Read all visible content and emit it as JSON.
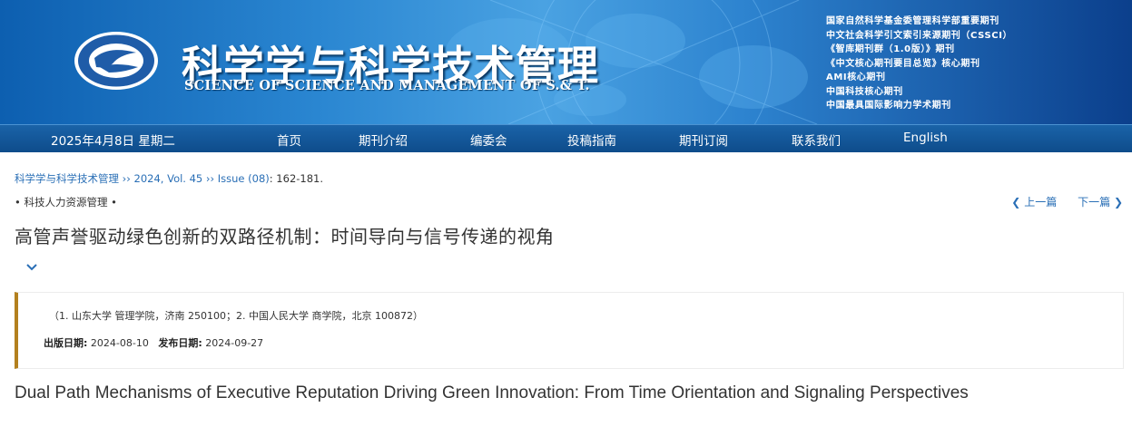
{
  "banner": {
    "journal_title_cn": "科学学与科学技术管理",
    "journal_title_en": "SCIENCE OF SCIENCE AND MANAGEMENT OF S.& T.",
    "indexing": [
      "国家自然科学基金委管理科学部重要期刊",
      "中文社会科学引文索引来源期刊（CSSCI）",
      "《智库期刊群（1.0版）》期刊",
      "《中文核心期刊要目总览》核心期刊",
      "AMI核心期刊",
      "中国科技核心期刊",
      "中国最具国际影响力学术期刊"
    ]
  },
  "nav": {
    "date": "2025年4月8日 星期二",
    "items": [
      "首页",
      "期刊介绍",
      "编委会",
      "投稿指南",
      "期刊订阅",
      "联系我们",
      "English"
    ]
  },
  "breadcrumb": {
    "journal": "科学学与科学技术管理",
    "sep": "››",
    "year_vol": "2024, Vol. 45",
    "issue": "Issue (08)",
    "pages": ": 162-181."
  },
  "article": {
    "column": "• 科技人力资源管理 •",
    "prev_label": "上一篇",
    "next_label": "下一篇",
    "title_cn": "高管声誉驱动绿色创新的双路径机制：时间导向与信号传递的视角",
    "affiliations": "（1. 山东大学 管理学院，济南 250100；2. 中国人民大学 商学院，北京 100872）",
    "pub_date_label": "出版日期:",
    "pub_date": "2024-08-10",
    "release_date_label": "发布日期:",
    "release_date": "2024-09-27",
    "title_en": "Dual Path Mechanisms of Executive Reputation Driving Green Innovation: From Time Orientation and Signaling Perspectives"
  },
  "colors": {
    "banner_blue": "#2a86d1",
    "nav_blue": "#0e4c8b",
    "link_blue": "#2a6fb6",
    "accent_gold": "#b3801e"
  }
}
